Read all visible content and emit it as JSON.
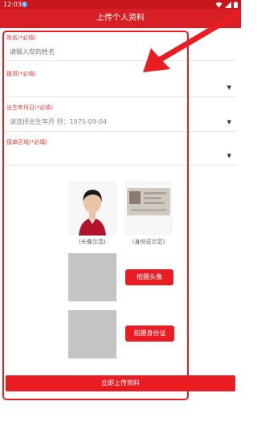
{
  "status_bar": {
    "time": "12:03",
    "badge": "§"
  },
  "title": "上传个人资料",
  "form": {
    "name": {
      "label": "姓名(*必填)",
      "placeholder": "请输入您的姓名"
    },
    "origin": {
      "label": "籍贯(*必填)",
      "value": ""
    },
    "birth": {
      "label": "出生年月日(*必填)",
      "value": "请选择出生年月 例：1975-09-04"
    },
    "area": {
      "label": "接单区域(*必填)",
      "value": ""
    }
  },
  "samples": {
    "avatar_caption": "(头像示范)",
    "id_caption": "(身份证示范)"
  },
  "buttons": {
    "shoot_avatar": "拍摄头像",
    "shoot_id": "拍摄身份证",
    "submit": "立即上传资料"
  },
  "icons": {
    "dropdown": "triangle-down",
    "wifi": "wifi-icon",
    "signal": "signal-icon",
    "battery": "battery-icon"
  },
  "colors": {
    "accent": "#e91c22",
    "title_bg": "#d81f26",
    "label": "#e53935"
  }
}
